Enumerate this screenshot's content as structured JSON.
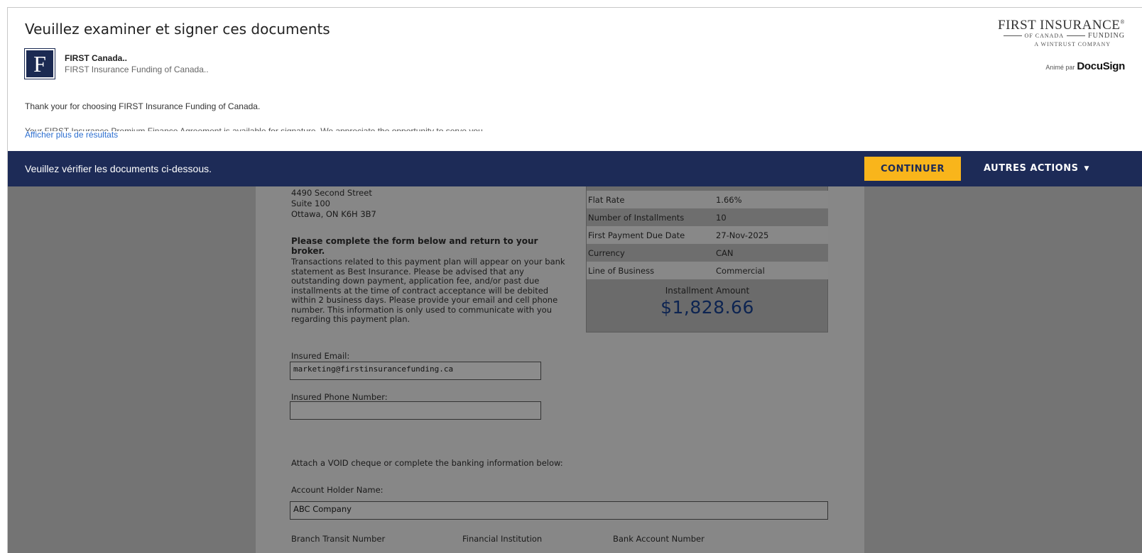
{
  "header": {
    "title": "Veuillez examiner et signer ces documents",
    "sender_name": "FIRST Canada..",
    "sender_org": "FIRST Insurance Funding of Canada..",
    "logo_letter": "F",
    "message_line1": "Thank your for choosing FIRST Insurance Funding of Canada.",
    "message_line2_partial": "Your FIRST Insurance Premium Finance Agreement is available for signature. We appreciate the opportunity to serve you.",
    "show_more_link": "Afficher plus de résultats"
  },
  "brand": {
    "name_main": "FIRST INSURANCE",
    "name_mark": "®",
    "name_of": "OF CANADA",
    "name_funding": "FUNDING",
    "tagline": "A WINTRUST COMPANY",
    "powered_by_prefix": "Animé par",
    "powered_by_name": "DocuSign"
  },
  "actionbar": {
    "message": "Veuillez vérifier les documents ci-dessous.",
    "continue_label": "CONTINUER",
    "more_actions_label": "AUTRES ACTIONS",
    "more_actions_caret": "▼"
  },
  "document": {
    "address": [
      "4490 Second Street",
      "Suite 100",
      "Ottawa, ON K6H 3B7"
    ],
    "instructions_title": "Please complete the form below and return to your broker.",
    "instructions_body": "Transactions related to this payment plan will appear on your bank statement as Best Insurance. Please be advised that any outstanding down payment, application fee, and/or past due installments at the time of contract acceptance will be debited within 2 business days. Please provide your email and cell phone number. This information is only used to communicate with you regarding this payment plan.",
    "email_label": "Insured Email:",
    "email_value": "marketing@firstinsurancefunding.ca",
    "phone_label": "Insured Phone Number:",
    "phone_value": "",
    "void_cheque_text": "Attach a VOID cheque or complete the banking information below:",
    "account_holder_label": "Account Holder Name:",
    "account_holder_value": "ABC Company",
    "bank_headers": [
      "Branch Transit Number",
      "Financial Institution",
      "Bank Account Number"
    ],
    "summary": {
      "rows": [
        {
          "label": "Flat Rate",
          "value": "1.66%"
        },
        {
          "label": "Number of Installments",
          "value": "10"
        },
        {
          "label": "First Payment Due Date",
          "value": "27-Nov-2025"
        },
        {
          "label": "Currency",
          "value": "CAN"
        },
        {
          "label": "Line of Business",
          "value": "Commercial"
        }
      ],
      "installment_label": "Installment Amount",
      "installment_amount": "$1,828.66"
    }
  }
}
